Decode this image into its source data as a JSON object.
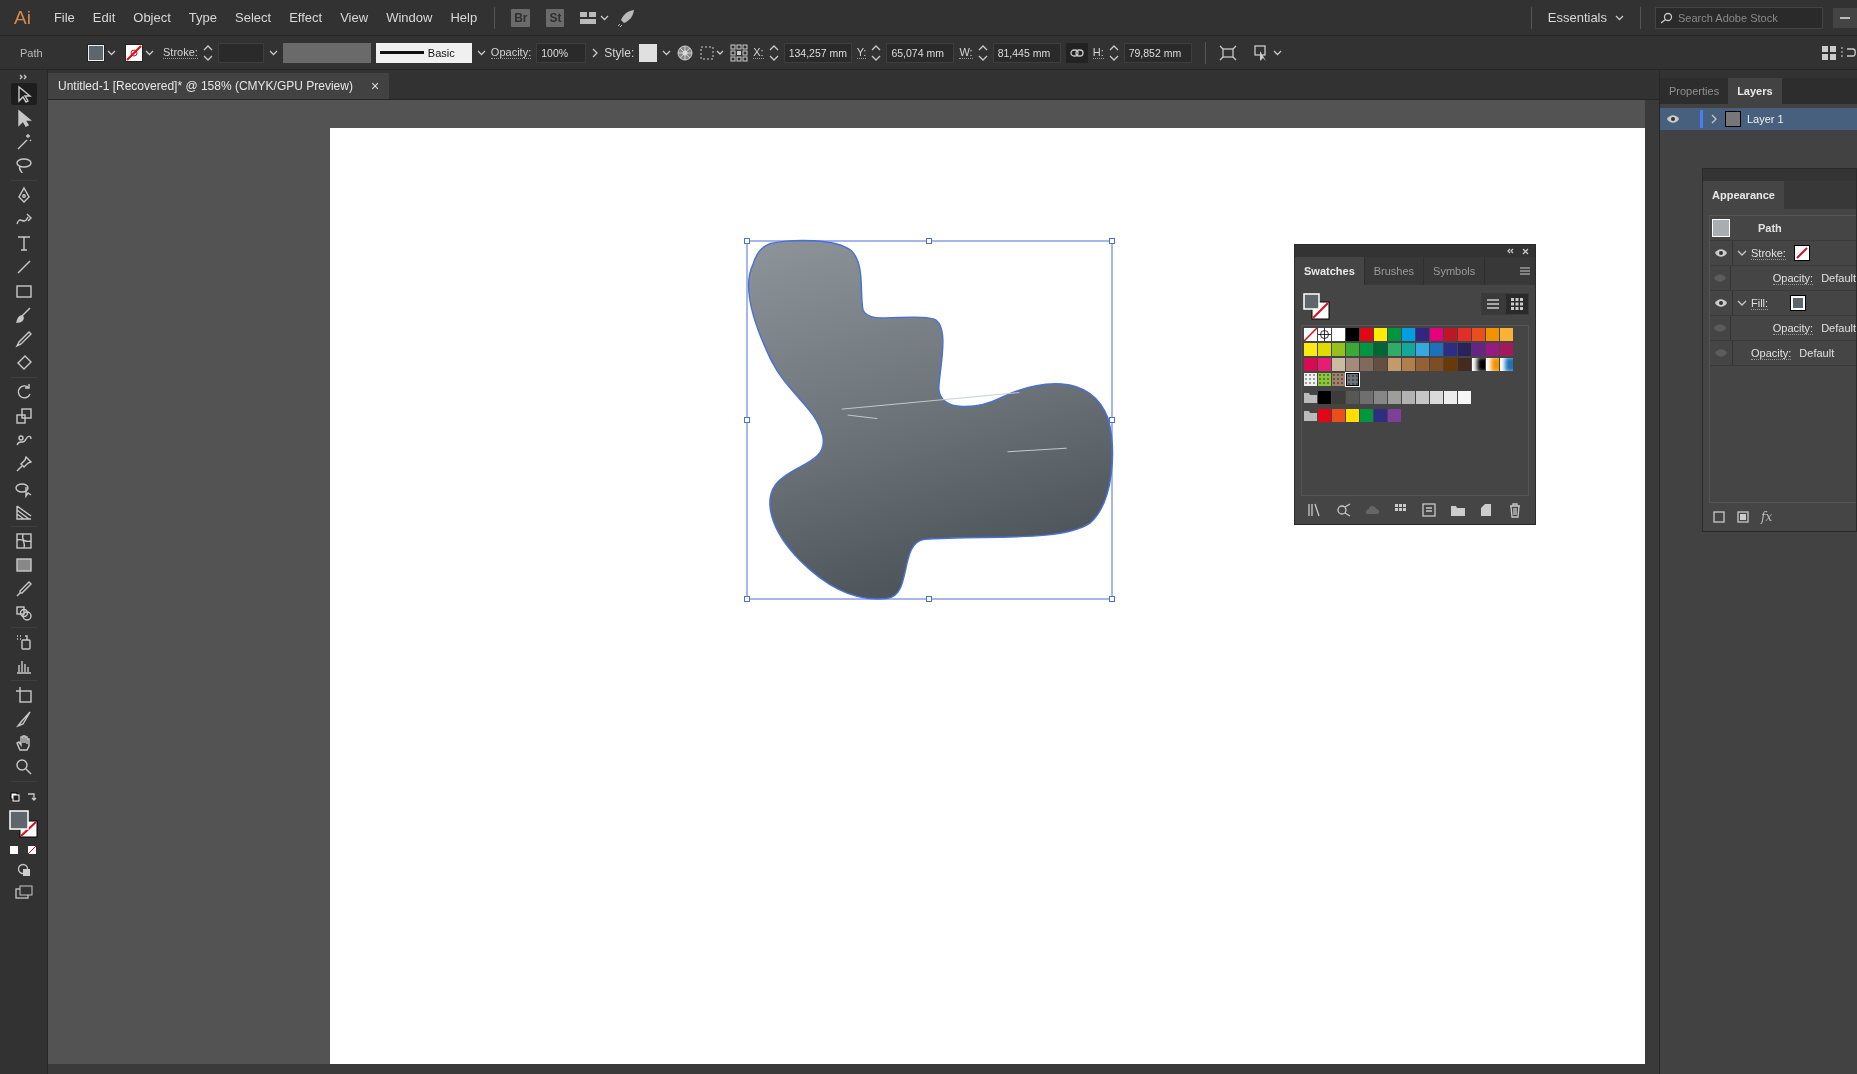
{
  "menu_bar": {
    "logo": "Ai",
    "menus": [
      "File",
      "Edit",
      "Object",
      "Type",
      "Select",
      "Effect",
      "View",
      "Window",
      "Help"
    ],
    "bridge": "Br",
    "stock": "St",
    "workspace": "Essentials",
    "search": {
      "placeholder": "Search Adobe Stock"
    }
  },
  "control_bar": {
    "selection": "Path",
    "stroke_label": "Stroke:",
    "brush": "Basic",
    "opacity_label": "Opacity:",
    "opacity": "100%",
    "style_label": "Style:",
    "constrain_proportions": true,
    "fields": [
      {
        "label": "X:",
        "value": "134,257 mm"
      },
      {
        "label": "Y:",
        "value": "65,074 mm"
      },
      {
        "label": "W:",
        "value": "81,445 mm"
      },
      {
        "label": "H:",
        "value": "79,852 mm"
      }
    ]
  },
  "document_tab": {
    "title": "Untitled-1 [Recovered]* @ 158% (CMYK/GPU Preview)",
    "close": "×"
  },
  "tool_groups": [
    [
      {
        "kind": "selection",
        "selected": true
      },
      {
        "kind": "direct",
        "selected": false
      },
      {
        "kind": "wand",
        "selected": false
      },
      {
        "kind": "lasso",
        "selected": false
      }
    ],
    [
      {
        "kind": "pen",
        "selected": false
      },
      {
        "kind": "curvature",
        "selected": false
      },
      {
        "kind": "type",
        "selected": false
      },
      {
        "kind": "line",
        "selected": false
      },
      {
        "kind": "rectangle",
        "selected": false
      },
      {
        "kind": "brush",
        "selected": false
      },
      {
        "kind": "pencil",
        "selected": false
      },
      {
        "kind": "eraser",
        "selected": false
      }
    ],
    [
      {
        "kind": "rotate",
        "selected": false
      },
      {
        "kind": "scale",
        "selected": false
      },
      {
        "kind": "warp",
        "selected": false
      },
      {
        "kind": "pin",
        "selected": false
      },
      {
        "kind": "shapebuilder",
        "selected": false
      },
      {
        "kind": "perspective",
        "selected": false
      }
    ],
    [
      {
        "kind": "mesh",
        "selected": false
      },
      {
        "kind": "gradient",
        "selected": false
      },
      {
        "kind": "eyedropper",
        "selected": false
      },
      {
        "kind": "blend",
        "selected": false
      }
    ],
    [
      {
        "kind": "sprayer",
        "selected": false
      },
      {
        "kind": "graph",
        "selected": false
      }
    ],
    [
      {
        "kind": "artboard",
        "selected": false
      },
      {
        "kind": "slice",
        "selected": false
      },
      {
        "kind": "hand",
        "selected": false
      },
      {
        "kind": "zoom",
        "selected": false
      }
    ]
  ],
  "swatches_panel": {
    "tabs": [
      {
        "label": "Swatches",
        "selected": true
      },
      {
        "label": "Brushes",
        "selected": false
      },
      {
        "label": "Symbols",
        "selected": false
      }
    ],
    "view_buttons": [
      {
        "kind": "list",
        "selected": false
      },
      {
        "kind": "grid",
        "selected": true
      }
    ],
    "rows": [
      [
        {
          "kind": "none",
          "selected": false
        },
        {
          "kind": "registration",
          "selected": false
        },
        {
          "kind": "color",
          "color": "#ffffff",
          "selected": false
        },
        {
          "kind": "color",
          "color": "#000000",
          "selected": false
        },
        {
          "kind": "color",
          "color": "#e30613",
          "selected": false
        },
        {
          "kind": "color",
          "color": "#ffed00",
          "selected": false
        },
        {
          "kind": "color",
          "color": "#009640",
          "selected": false
        },
        {
          "kind": "color",
          "color": "#009fe3",
          "selected": false
        },
        {
          "kind": "color",
          "color": "#312783",
          "selected": false
        },
        {
          "kind": "color",
          "color": "#e6007e",
          "selected": false
        },
        {
          "kind": "color",
          "color": "#be1622",
          "selected": false
        },
        {
          "kind": "color",
          "color": "#e52d27",
          "selected": false
        },
        {
          "kind": "color",
          "color": "#e94e1b",
          "selected": false
        },
        {
          "kind": "color",
          "color": "#f39200",
          "selected": false
        },
        {
          "kind": "color",
          "color": "#f9b233",
          "selected": false
        }
      ],
      [
        {
          "kind": "color",
          "color": "#fcea10",
          "selected": false
        },
        {
          "kind": "color",
          "color": "#dedc00",
          "selected": false
        },
        {
          "kind": "color",
          "color": "#95c11f",
          "selected": false
        },
        {
          "kind": "color",
          "color": "#3aaa35",
          "selected": false
        },
        {
          "kind": "color",
          "color": "#009640",
          "selected": false
        },
        {
          "kind": "color",
          "color": "#006633",
          "selected": false
        },
        {
          "kind": "color",
          "color": "#2fac66",
          "selected": false
        },
        {
          "kind": "color",
          "color": "#13a89e",
          "selected": false
        },
        {
          "kind": "color",
          "color": "#36a9e1",
          "selected": false
        },
        {
          "kind": "color",
          "color": "#1d71b8",
          "selected": false
        },
        {
          "kind": "color",
          "color": "#2d2e83",
          "selected": false
        },
        {
          "kind": "color",
          "color": "#29235c",
          "selected": false
        },
        {
          "kind": "color",
          "color": "#662483",
          "selected": false
        },
        {
          "kind": "color",
          "color": "#951b81",
          "selected": false
        },
        {
          "kind": "color",
          "color": "#a3195b",
          "selected": false
        }
      ],
      [
        {
          "kind": "color",
          "color": "#d60b52",
          "selected": false
        },
        {
          "kind": "color",
          "color": "#e71d73",
          "selected": false
        },
        {
          "kind": "color",
          "color": "#cbbba0",
          "selected": false
        },
        {
          "kind": "color",
          "color": "#a48a7b",
          "selected": false
        },
        {
          "kind": "color",
          "color": "#806a5c",
          "selected": false
        },
        {
          "kind": "color",
          "color": "#634e42",
          "selected": false
        },
        {
          "kind": "color",
          "color": "#c49a6c",
          "selected": false
        },
        {
          "kind": "color",
          "color": "#b17f4a",
          "selected": false
        },
        {
          "kind": "color",
          "color": "#936037",
          "selected": false
        },
        {
          "kind": "color",
          "color": "#7d4e24",
          "selected": false
        },
        {
          "kind": "color",
          "color": "#6a3906",
          "selected": false
        },
        {
          "kind": "color",
          "color": "#442a1f",
          "selected": false
        },
        {
          "kind": "gradient",
          "color": "#000000",
          "selected": false
        },
        {
          "kind": "gradient",
          "color": "#f39200",
          "selected": false
        },
        {
          "kind": "gradient",
          "color": "#1d71b8",
          "selected": false
        }
      ],
      [
        {
          "kind": "pattern",
          "color": "#f0f0f0",
          "selected": false
        },
        {
          "kind": "pattern",
          "color": "#8cc63f",
          "selected": false
        },
        {
          "kind": "pattern",
          "color": "#a0826d",
          "selected": false
        },
        {
          "kind": "pattern",
          "color": "#6d757c",
          "selected": true
        }
      ],
      [
        {
          "kind": "folder",
          "selected": false
        },
        {
          "kind": "color",
          "color": "#000000",
          "selected": false
        },
        {
          "kind": "color",
          "color": "#3c3c3b",
          "selected": false
        },
        {
          "kind": "color",
          "color": "#575756",
          "selected": false
        },
        {
          "kind": "color",
          "color": "#706f6f",
          "selected": false
        },
        {
          "kind": "color",
          "color": "#878787",
          "selected": false
        },
        {
          "kind": "color",
          "color": "#9d9d9c",
          "selected": false
        },
        {
          "kind": "color",
          "color": "#b2b2b2",
          "selected": false
        },
        {
          "kind": "color",
          "color": "#c6c6c6",
          "selected": false
        },
        {
          "kind": "color",
          "color": "#dadada",
          "selected": false
        },
        {
          "kind": "color",
          "color": "#ededed",
          "selected": false
        },
        {
          "kind": "color",
          "color": "#f6f6f6",
          "selected": false
        }
      ],
      [
        {
          "kind": "folder",
          "selected": false
        },
        {
          "kind": "color",
          "color": "#e30613",
          "selected": false
        },
        {
          "kind": "color",
          "color": "#e94e1b",
          "selected": false
        },
        {
          "kind": "color",
          "color": "#ffde00",
          "selected": false
        },
        {
          "kind": "color",
          "color": "#009640",
          "selected": false
        },
        {
          "kind": "color",
          "color": "#2d2e83",
          "selected": false
        },
        {
          "kind": "color",
          "color": "#7f3f98",
          "selected": false
        }
      ]
    ]
  },
  "dock_tabs": [
    {
      "label": "Properties",
      "selected": false
    },
    {
      "label": "Layers",
      "selected": true
    }
  ],
  "layers": [
    {
      "name": "Layer 1",
      "visible": true,
      "expanded": false,
      "selected": true
    }
  ],
  "appearance_panel": {
    "title": "Appearance",
    "object": "Path",
    "fx": "fx",
    "rows": [
      {
        "kind": "stroke",
        "label": "Stroke:",
        "expanded": true,
        "children": [
          {
            "kind": "opacity",
            "label": "Opacity:",
            "value": "Default"
          }
        ]
      },
      {
        "kind": "fill",
        "label": "Fill:",
        "expanded": true,
        "children": [
          {
            "kind": "opacity",
            "label": "Opacity:",
            "value": "Default"
          }
        ]
      },
      {
        "kind": "opacity",
        "label": "Opacity:",
        "value": "Default"
      }
    ]
  }
}
